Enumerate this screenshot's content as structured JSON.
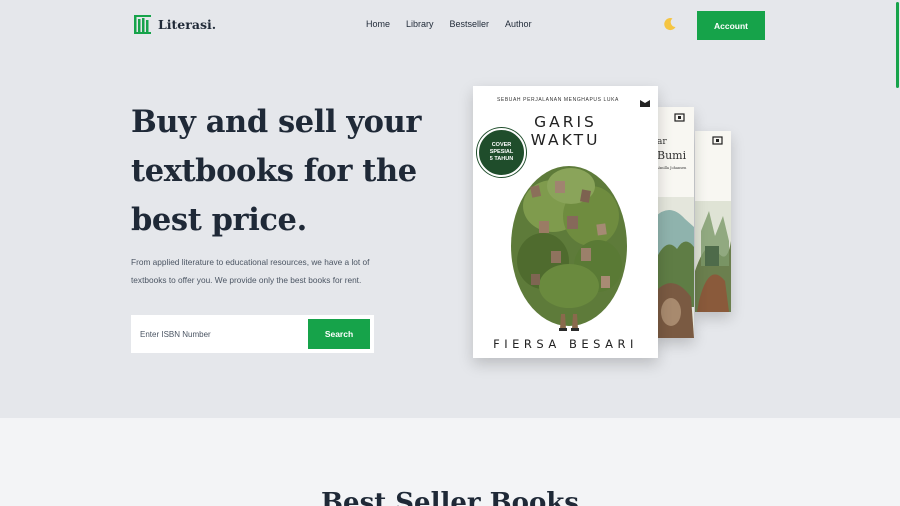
{
  "header": {
    "logo_text": "Literasi.",
    "nav": [
      "Home",
      "Library",
      "Bestseller",
      "Author"
    ],
    "account_label": "Account"
  },
  "hero": {
    "headline": "Buy and sell your textbooks for the best price.",
    "description": "From applied literature to educational resources, we have a lot of textbooks to offer you. We provide only the best books for rent.",
    "search": {
      "placeholder": "Enter ISBN Number",
      "button_label": "Search"
    }
  },
  "books": {
    "main": {
      "tagline": "SEBUAH PERJALANAN MENGHAPUS LUKA",
      "title_line1": "GARIS",
      "title_line2": "WAKTU",
      "badge_line1": "COVER",
      "badge_line2": "SPESIAL",
      "badge_line3": "5 TAHUN",
      "author": "FIERSA BESARI"
    },
    "second": {
      "line1": "ar",
      "line2": "Bumi",
      "line3": "Vanilla Johansen"
    }
  },
  "section": {
    "title": "Best Seller Books"
  },
  "colors": {
    "accent": "#16a34a",
    "hero_bg": "#e5e7eb",
    "page_bg": "#f3f4f6",
    "text": "#1f2937"
  },
  "icons": {
    "logo": "book-stack-icon",
    "theme": "moon-icon",
    "publisher": "gramedia-logo-icon"
  }
}
